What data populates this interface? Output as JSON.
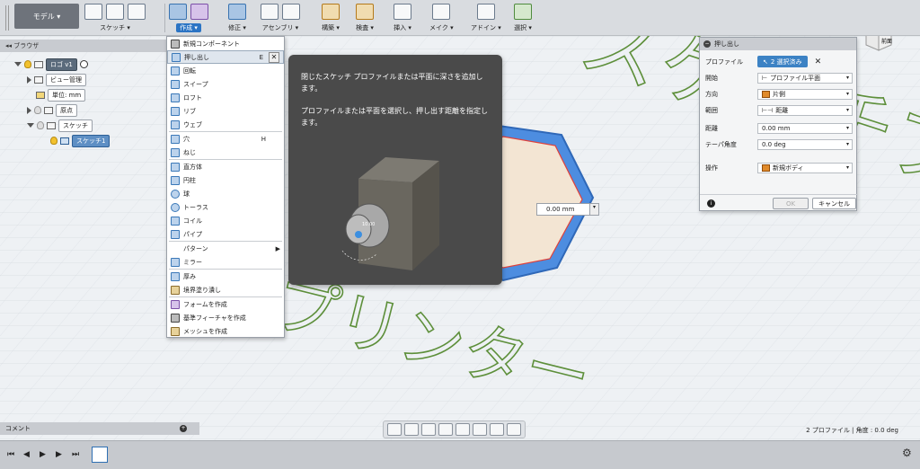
{
  "toolbar": {
    "mode": "モデル ▾",
    "groups": [
      {
        "label": "スケッチ ▾"
      },
      {
        "label": "作成 ▾"
      },
      {
        "label": "修正 ▾"
      },
      {
        "label": "アセンブリ ▾"
      },
      {
        "label": "構築 ▾"
      },
      {
        "label": "検査 ▾"
      },
      {
        "label": "挿入 ▾"
      },
      {
        "label": "メイク ▾"
      },
      {
        "label": "アドイン ▾"
      },
      {
        "label": "選択 ▾"
      }
    ]
  },
  "browser": {
    "title": "ブラウザ",
    "items": [
      {
        "label": "ロゴ v1"
      },
      {
        "label": "ビュー管理"
      },
      {
        "label": "単位: mm"
      },
      {
        "label": "原点"
      },
      {
        "label": "スケッチ"
      },
      {
        "label": "スケッチ1"
      }
    ]
  },
  "create_menu": {
    "items": [
      {
        "label": "新規コンポーネント",
        "shortcut": ""
      },
      {
        "label": "押し出し",
        "shortcut": "E"
      },
      {
        "label": "回転",
        "shortcut": ""
      },
      {
        "label": "スイープ",
        "shortcut": ""
      },
      {
        "label": "ロフト",
        "shortcut": ""
      },
      {
        "label": "リブ",
        "shortcut": ""
      },
      {
        "label": "ウェブ",
        "shortcut": ""
      },
      {
        "label": "穴",
        "shortcut": "H"
      },
      {
        "label": "ねじ",
        "shortcut": ""
      },
      {
        "label": "直方体",
        "shortcut": ""
      },
      {
        "label": "円柱",
        "shortcut": ""
      },
      {
        "label": "球",
        "shortcut": ""
      },
      {
        "label": "トーラス",
        "shortcut": ""
      },
      {
        "label": "コイル",
        "shortcut": ""
      },
      {
        "label": "パイプ",
        "shortcut": ""
      },
      {
        "label": "パターン",
        "shortcut": ""
      },
      {
        "label": "ミラー",
        "shortcut": ""
      },
      {
        "label": "厚み",
        "shortcut": ""
      },
      {
        "label": "境界塗り潰し",
        "shortcut": ""
      },
      {
        "label": "フォームを作成",
        "shortcut": ""
      },
      {
        "label": "基準フィーチャを作成",
        "shortcut": ""
      },
      {
        "label": "メッシュを作成",
        "shortcut": ""
      }
    ]
  },
  "tooltip": {
    "para1": "閉じたスケッチ プロファイルまたは平面に深さを追加します。",
    "para2": "プロファイルまたは平面を選択し、押し出す距離を指定します。",
    "image_label": "10.00"
  },
  "canvas": {
    "dim_value": "0.00 mm",
    "text_top": "スケッチプリンター",
    "text_bottom": "プリンター"
  },
  "extrude_panel": {
    "title": "押し出し",
    "rows": [
      {
        "key": "プロファイル",
        "value": "2 選択済み"
      },
      {
        "key": "開始",
        "value": "プロファイル平面"
      },
      {
        "key": "方向",
        "value": "片側"
      },
      {
        "key": "範囲",
        "value": "距離"
      },
      {
        "key": "距離",
        "value": "0.00 mm"
      },
      {
        "key": "テーパ角度",
        "value": "0.0 deg"
      },
      {
        "key": "操作",
        "value": "新規ボディ"
      }
    ],
    "ok": "OK",
    "cancel": "キャンセル"
  },
  "comment": {
    "label": "コメント"
  },
  "status": {
    "text": "2 プロファイル | 角度 : 0.0 deg"
  },
  "viewcube": {
    "top": "上",
    "front": "前面"
  },
  "colors": {
    "accent": "#2b74c4",
    "profile_fill": "#f3e5d3",
    "profile_outline": "#4d8de0",
    "sketch_text": "#5d8f3a"
  }
}
